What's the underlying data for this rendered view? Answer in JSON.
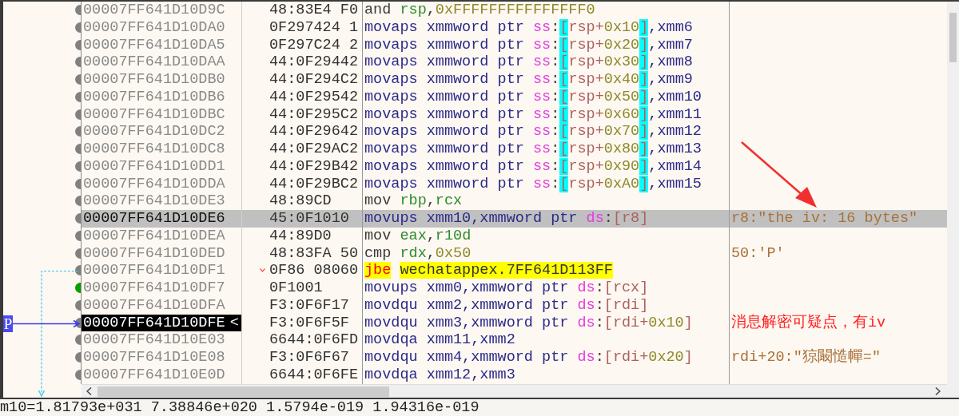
{
  "rows": [
    {
      "address": "00007FF641D10D9C",
      "bytes": "48:83E4 F0",
      "color": "#808080",
      "selected": false,
      "current": false,
      "jump": false,
      "instruction": [
        {
          "text": "and ",
          "kind": "op"
        },
        {
          "text": "rsp",
          "kind": "reg"
        },
        {
          "text": ",",
          "kind": "op"
        },
        {
          "text": "0xFFFFFFFFFFFFFFF0",
          "kind": "num"
        }
      ]
    },
    {
      "address": "00007FF641D10DA0",
      "bytes": "0F297424 1",
      "color": "#808080",
      "selected": false,
      "current": false,
      "jump": false,
      "instruction": [
        {
          "text": "movaps xmmword ptr ",
          "kind": "sse"
        },
        {
          "text": "ss",
          "kind": "seg"
        },
        {
          "text": ":",
          "kind": "op"
        },
        {
          "text": "[",
          "kind": "bracket-hl"
        },
        {
          "text": "rsp+",
          "kind": "mem"
        },
        {
          "text": "0x10",
          "kind": "num"
        },
        {
          "text": "]",
          "kind": "bracket-hl"
        },
        {
          "text": ",xmm6",
          "kind": "sse"
        }
      ]
    },
    {
      "address": "00007FF641D10DA5",
      "bytes": "0F297C24 2",
      "color": "#808080",
      "selected": false,
      "current": false,
      "jump": false,
      "instruction": [
        {
          "text": "movaps xmmword ptr ",
          "kind": "sse"
        },
        {
          "text": "ss",
          "kind": "seg"
        },
        {
          "text": ":",
          "kind": "op"
        },
        {
          "text": "[",
          "kind": "bracket-hl"
        },
        {
          "text": "rsp+",
          "kind": "mem"
        },
        {
          "text": "0x20",
          "kind": "num"
        },
        {
          "text": "]",
          "kind": "bracket-hl"
        },
        {
          "text": ",xmm7",
          "kind": "sse"
        }
      ]
    },
    {
      "address": "00007FF641D10DAA",
      "bytes": "44:0F29442",
      "color": "#808080",
      "selected": false,
      "current": false,
      "jump": false,
      "instruction": [
        {
          "text": "movaps xmmword ptr ",
          "kind": "sse"
        },
        {
          "text": "ss",
          "kind": "seg"
        },
        {
          "text": ":",
          "kind": "op"
        },
        {
          "text": "[",
          "kind": "bracket-hl"
        },
        {
          "text": "rsp+",
          "kind": "mem"
        },
        {
          "text": "0x30",
          "kind": "num"
        },
        {
          "text": "]",
          "kind": "bracket-hl"
        },
        {
          "text": ",xmm8",
          "kind": "sse"
        }
      ]
    },
    {
      "address": "00007FF641D10DB0",
      "bytes": "44:0F294C2",
      "color": "#808080",
      "selected": false,
      "current": false,
      "jump": false,
      "instruction": [
        {
          "text": "movaps xmmword ptr ",
          "kind": "sse"
        },
        {
          "text": "ss",
          "kind": "seg"
        },
        {
          "text": ":",
          "kind": "op"
        },
        {
          "text": "[",
          "kind": "bracket-hl"
        },
        {
          "text": "rsp+",
          "kind": "mem"
        },
        {
          "text": "0x40",
          "kind": "num"
        },
        {
          "text": "]",
          "kind": "bracket-hl"
        },
        {
          "text": ",xmm9",
          "kind": "sse"
        }
      ]
    },
    {
      "address": "00007FF641D10DB6",
      "bytes": "44:0F29542",
      "color": "#808080",
      "selected": false,
      "current": false,
      "jump": false,
      "instruction": [
        {
          "text": "movaps xmmword ptr ",
          "kind": "sse"
        },
        {
          "text": "ss",
          "kind": "seg"
        },
        {
          "text": ":",
          "kind": "op"
        },
        {
          "text": "[",
          "kind": "bracket-hl"
        },
        {
          "text": "rsp+",
          "kind": "mem"
        },
        {
          "text": "0x50",
          "kind": "num"
        },
        {
          "text": "]",
          "kind": "bracket-hl"
        },
        {
          "text": ",xmm10",
          "kind": "sse"
        }
      ]
    },
    {
      "address": "00007FF641D10DBC",
      "bytes": "44:0F295C2",
      "color": "#808080",
      "selected": false,
      "current": false,
      "jump": false,
      "instruction": [
        {
          "text": "movaps xmmword ptr ",
          "kind": "sse"
        },
        {
          "text": "ss",
          "kind": "seg"
        },
        {
          "text": ":",
          "kind": "op"
        },
        {
          "text": "[",
          "kind": "bracket-hl"
        },
        {
          "text": "rsp+",
          "kind": "mem"
        },
        {
          "text": "0x60",
          "kind": "num"
        },
        {
          "text": "]",
          "kind": "bracket-hl"
        },
        {
          "text": ",xmm11",
          "kind": "sse"
        }
      ]
    },
    {
      "address": "00007FF641D10DC2",
      "bytes": "44:0F29642",
      "color": "#808080",
      "selected": false,
      "current": false,
      "jump": false,
      "instruction": [
        {
          "text": "movaps xmmword ptr ",
          "kind": "sse"
        },
        {
          "text": "ss",
          "kind": "seg"
        },
        {
          "text": ":",
          "kind": "op"
        },
        {
          "text": "[",
          "kind": "bracket-hl"
        },
        {
          "text": "rsp+",
          "kind": "mem"
        },
        {
          "text": "0x70",
          "kind": "num"
        },
        {
          "text": "]",
          "kind": "bracket-hl"
        },
        {
          "text": ",xmm12",
          "kind": "sse"
        }
      ]
    },
    {
      "address": "00007FF641D10DC8",
      "bytes": "44:0F29AC2",
      "color": "#808080",
      "selected": false,
      "current": false,
      "jump": false,
      "instruction": [
        {
          "text": "movaps xmmword ptr ",
          "kind": "sse"
        },
        {
          "text": "ss",
          "kind": "seg"
        },
        {
          "text": ":",
          "kind": "op"
        },
        {
          "text": "[",
          "kind": "bracket-hl"
        },
        {
          "text": "rsp+",
          "kind": "mem"
        },
        {
          "text": "0x80",
          "kind": "num"
        },
        {
          "text": "]",
          "kind": "bracket-hl"
        },
        {
          "text": ",xmm13",
          "kind": "sse"
        }
      ]
    },
    {
      "address": "00007FF641D10DD1",
      "bytes": "44:0F29B42",
      "color": "#808080",
      "selected": false,
      "current": false,
      "jump": false,
      "instruction": [
        {
          "text": "movaps xmmword ptr ",
          "kind": "sse"
        },
        {
          "text": "ss",
          "kind": "seg"
        },
        {
          "text": ":",
          "kind": "op"
        },
        {
          "text": "[",
          "kind": "bracket-hl"
        },
        {
          "text": "rsp+",
          "kind": "mem"
        },
        {
          "text": "0x90",
          "kind": "num"
        },
        {
          "text": "]",
          "kind": "bracket-hl"
        },
        {
          "text": ",xmm14",
          "kind": "sse"
        }
      ]
    },
    {
      "address": "00007FF641D10DDA",
      "bytes": "44:0F29BC2",
      "color": "#808080",
      "selected": false,
      "current": false,
      "jump": false,
      "instruction": [
        {
          "text": "movaps xmmword ptr ",
          "kind": "sse"
        },
        {
          "text": "ss",
          "kind": "seg"
        },
        {
          "text": ":",
          "kind": "op"
        },
        {
          "text": "[",
          "kind": "bracket-hl"
        },
        {
          "text": "rsp+",
          "kind": "mem"
        },
        {
          "text": "0xA0",
          "kind": "num"
        },
        {
          "text": "]",
          "kind": "bracket-hl"
        },
        {
          "text": ",xmm15",
          "kind": "sse"
        }
      ]
    },
    {
      "address": "00007FF641D10DE3",
      "bytes": "48:89CD",
      "color": "#808080",
      "selected": false,
      "current": false,
      "jump": false,
      "instruction": [
        {
          "text": "mov ",
          "kind": "op"
        },
        {
          "text": "rbp",
          "kind": "reg"
        },
        {
          "text": ",",
          "kind": "op"
        },
        {
          "text": "rcx",
          "kind": "reg"
        }
      ]
    },
    {
      "address": "00007FF641D10DE6",
      "bytes": "45:0F1010",
      "color": "#808080",
      "selected": true,
      "current": false,
      "jump": false,
      "instruction": [
        {
          "text": "movups xmm10,xmmword ptr ",
          "kind": "sse"
        },
        {
          "text": "ds",
          "kind": "seg"
        },
        {
          "text": ":",
          "kind": "op"
        },
        {
          "text": "[r8]",
          "kind": "mem"
        }
      ],
      "comment": {
        "text": "r8:\"the iv: 16 bytes\"",
        "kind": "auto"
      }
    },
    {
      "address": "00007FF641D10DEA",
      "bytes": "44:89D0",
      "color": "#808080",
      "selected": false,
      "current": false,
      "jump": false,
      "instruction": [
        {
          "text": "mov ",
          "kind": "op"
        },
        {
          "text": "eax",
          "kind": "reg"
        },
        {
          "text": ",",
          "kind": "op"
        },
        {
          "text": "r10d",
          "kind": "reg"
        }
      ]
    },
    {
      "address": "00007FF641D10DED",
      "bytes": "48:83FA 50",
      "color": "#808080",
      "selected": false,
      "current": false,
      "jump": false,
      "instruction": [
        {
          "text": "cmp ",
          "kind": "op"
        },
        {
          "text": "rdx",
          "kind": "reg"
        },
        {
          "text": ",",
          "kind": "op"
        },
        {
          "text": "0x50",
          "kind": "num"
        }
      ],
      "comment": {
        "text": "50:'P'",
        "kind": "auto"
      }
    },
    {
      "address": "00007FF641D10DF1",
      "bytes": "0F86 08060",
      "color": "#808080",
      "selected": false,
      "current": false,
      "jump": true,
      "instruction": [
        {
          "text": "jbe",
          "kind": "jcc"
        },
        {
          "text": "wechatappex.7FF641D113FF",
          "kind": "target"
        }
      ]
    },
    {
      "address": "00007FF641D10DF7",
      "bytes": "0F1001",
      "color": "#00a000",
      "selected": false,
      "current": false,
      "jump": false,
      "instruction": [
        {
          "text": "movups xmm0,xmmword ptr ",
          "kind": "sse"
        },
        {
          "text": "ds",
          "kind": "seg"
        },
        {
          "text": ":",
          "kind": "op"
        },
        {
          "text": "[rcx]",
          "kind": "mem"
        }
      ]
    },
    {
      "address": "00007FF641D10DFA",
      "bytes": "F3:0F6F17",
      "color": "#808080",
      "selected": false,
      "current": false,
      "jump": false,
      "instruction": [
        {
          "text": "movdqu xmm2,xmmword ptr ",
          "kind": "sse"
        },
        {
          "text": "ds",
          "kind": "seg"
        },
        {
          "text": ":",
          "kind": "op"
        },
        {
          "text": "[rdi]",
          "kind": "mem"
        }
      ]
    },
    {
      "address": "00007FF641D10DFE",
      "marker": "<",
      "bytes": "F3:0F6F5F",
      "color": "#808080",
      "selected": false,
      "current": true,
      "jump": false,
      "instruction": [
        {
          "text": "movdqu xmm3,xmmword ptr ",
          "kind": "sse"
        },
        {
          "text": "ds",
          "kind": "seg"
        },
        {
          "text": ":",
          "kind": "op"
        },
        {
          "text": "[rdi+",
          "kind": "mem"
        },
        {
          "text": "0x10",
          "kind": "num"
        },
        {
          "text": "]",
          "kind": "mem"
        }
      ],
      "comment": {
        "text": "消息解密可疑点，有iv",
        "kind": "user"
      }
    },
    {
      "address": "00007FF641D10E03",
      "bytes": "6644:0F6FD",
      "color": "#808080",
      "selected": false,
      "current": false,
      "jump": false,
      "instruction": [
        {
          "text": "movdqa xmm11,xmm2",
          "kind": "sse"
        }
      ]
    },
    {
      "address": "00007FF641D10E08",
      "bytes": "F3:0F6F67",
      "color": "#808080",
      "selected": false,
      "current": false,
      "jump": false,
      "instruction": [
        {
          "text": "movdqu xmm4,xmmword ptr ",
          "kind": "sse"
        },
        {
          "text": "ds",
          "kind": "seg"
        },
        {
          "text": ":",
          "kind": "op"
        },
        {
          "text": "[rdi+",
          "kind": "mem"
        },
        {
          "text": "0x20",
          "kind": "num"
        },
        {
          "text": "]",
          "kind": "mem"
        }
      ],
      "comment": {
        "text": "rdi+20:\"猄闞慥幝=\"",
        "kind": "auto"
      }
    },
    {
      "address": "00007FF641D10E0D",
      "bytes": "6644:0F6FE",
      "color": "#808080",
      "selected": false,
      "current": false,
      "jump": false,
      "instruction": [
        {
          "text": "movdqa xmm12,xmm3",
          "kind": "sse"
        }
      ]
    }
  ],
  "rip_label": "P",
  "status_text": "m10=1.81793e+031 7.38846e+020 1.5794e-019 1.94316e-019"
}
